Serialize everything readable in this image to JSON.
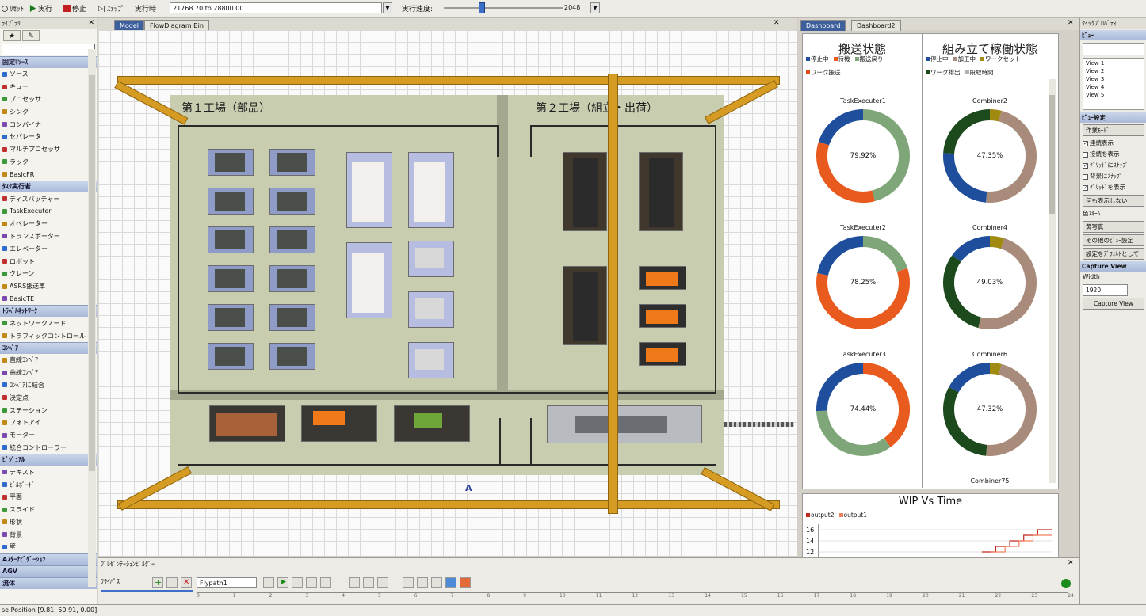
{
  "toolbar": {
    "reset_label": "ﾘｾｯﾄ",
    "run_label": "実行",
    "stop_label": "停止",
    "step_label": "ｽﾃｯﾌﾟ",
    "run_time_label": "実行時",
    "run_time_value": "21768.70  to  28800.00",
    "speed_label": "実行速度:",
    "speed_value": "2048"
  },
  "library": {
    "title": "ﾗｲﾌﾞﾗﾘ",
    "groups": [
      {
        "name": "固定ﾘｿｰｽ",
        "items": [
          "ソース",
          "キュー",
          "プロセッサ",
          "シンク",
          "コンバイナ",
          "セパレータ",
          "マルチプロセッサ",
          "ラック",
          "BasicFR"
        ]
      },
      {
        "name": "ﾀｽｸ実行者",
        "items": [
          "ディスパッチャー",
          "TaskExecuter",
          "オペレーター",
          "トランスポーター",
          "エレベーター",
          "ロボット",
          "クレーン",
          "ASRS搬送車",
          "BasicTE"
        ]
      },
      {
        "name": "ﾄﾗﾍﾞﾙﾈｯﾄﾜｰｸ",
        "items": [
          "ネットワークノード",
          "トラフィックコントロール"
        ]
      },
      {
        "name": "ｺﾝﾍﾞｱ",
        "items": [
          "直線ｺﾝﾍﾞｱ",
          "曲線ｺﾝﾍﾞｱ",
          "ｺﾝﾍﾞｱに結合",
          "決定点",
          "ステーション",
          "フォトアイ",
          "モーター",
          "統合コントローラー"
        ]
      },
      {
        "name": "ﾋﾞｼﾞｭｱﾙ",
        "items": [
          "テキスト",
          "ﾋﾞﾙﾎﾞｰﾄﾞ",
          "平面",
          "スライド",
          "形状",
          "背景",
          "壁"
        ]
      },
      {
        "name": "Aｽﾀｰﾅﾋﾞｹﾞｰｼｮﾝ",
        "items": []
      },
      {
        "name": "AGV",
        "items": []
      },
      {
        "name": "流体",
        "items": []
      }
    ]
  },
  "model_view": {
    "tabs": [
      "Model",
      "FlowDiagram Bin"
    ],
    "factory1_label": "第１工場（部品）",
    "factory2_label": "第２工場（組立・出荷）",
    "marker": "A"
  },
  "dashboard": {
    "tabs": [
      "Dashboard",
      "Dashboard2"
    ],
    "left_title": "搬送状態",
    "right_title": "組み立て稼働状態",
    "left_legend": [
      {
        "label": "停止中",
        "color": "#1f4e9c"
      },
      {
        "label": "待機",
        "color": "#e85a1e"
      },
      {
        "label": "搬送戻り",
        "color": "#7fa678"
      },
      {
        "label": "ワーク搬送",
        "color": "#e04a14"
      }
    ],
    "right_legend": [
      {
        "label": "停止中",
        "color": "#1f4e9c"
      },
      {
        "label": "加工中",
        "color": "#a88b7a"
      },
      {
        "label": "ワークセット",
        "color": "#a08a10"
      },
      {
        "label": "ワーク排出",
        "color": "#1c4a1c"
      },
      {
        "label": "段取時間",
        "color": "#b0b0b0"
      }
    ],
    "left_rings": [
      {
        "name": "TaskExecuter1",
        "pct": "79.92%",
        "segments": [
          {
            "v": 0.4592,
            "c": "#7fa678"
          },
          {
            "v": 0.34,
            "c": "#e85a1e"
          },
          {
            "v": 0.2008,
            "c": "#1f4e9c"
          }
        ]
      },
      {
        "name": "TaskExecuter2",
        "pct": "78.25%",
        "segments": [
          {
            "v": 0.2,
            "c": "#7fa678"
          },
          {
            "v": 0.5825,
            "c": "#e85a1e"
          },
          {
            "v": 0.2175,
            "c": "#1f4e9c"
          }
        ]
      },
      {
        "name": "TaskExecuter3",
        "pct": "74.44%",
        "segments": [
          {
            "v": 0.4,
            "c": "#e85a1e"
          },
          {
            "v": 0.3444,
            "c": "#7fa678"
          },
          {
            "v": 0.2556,
            "c": "#1f4e9c"
          }
        ]
      }
    ],
    "right_rings": [
      {
        "name": "Combiner2",
        "pct": "47.35%",
        "segments": [
          {
            "v": 0.04,
            "c": "#a08a10"
          },
          {
            "v": 0.4735,
            "c": "#a88b7a"
          },
          {
            "v": 0.2465,
            "c": "#1f4e9c"
          },
          {
            "v": 0.24,
            "c": "#1c4a1c"
          }
        ]
      },
      {
        "name": "Combiner4",
        "pct": "49.03%",
        "segments": [
          {
            "v": 0.05,
            "c": "#a08a10"
          },
          {
            "v": 0.4903,
            "c": "#a88b7a"
          },
          {
            "v": 0.3097,
            "c": "#1c4a1c"
          },
          {
            "v": 0.15,
            "c": "#1f4e9c"
          }
        ]
      },
      {
        "name": "Combiner6",
        "pct": "47.32%",
        "segments": [
          {
            "v": 0.04,
            "c": "#a08a10"
          },
          {
            "v": 0.4732,
            "c": "#a88b7a"
          },
          {
            "v": 0.3168,
            "c": "#1c4a1c"
          },
          {
            "v": 0.17,
            "c": "#1f4e9c"
          }
        ]
      }
    ],
    "right_bottom_label": "Combiner75"
  },
  "wip_chart": {
    "title": "WIP Vs Time",
    "legend": [
      {
        "label": "output2",
        "color": "#c0281c"
      },
      {
        "label": "output1",
        "color": "#f08060"
      }
    ],
    "yticks": [
      "16",
      "14",
      "12"
    ],
    "chart_data": {
      "type": "line",
      "title": "WIP Vs Time",
      "series": [
        {
          "name": "output2",
          "x": [
            0.7,
            0.76,
            0.76,
            0.82,
            0.82,
            0.88,
            0.88,
            0.94,
            0.94,
            1.0
          ],
          "y": [
            12,
            12,
            13,
            13,
            14,
            14,
            15,
            15,
            16,
            16
          ]
        },
        {
          "name": "output1",
          "x": [
            0.74,
            0.8,
            0.8,
            0.86,
            0.86,
            0.92,
            0.92,
            1.0
          ],
          "y": [
            12,
            12,
            13,
            13,
            14,
            14,
            15,
            15
          ]
        }
      ],
      "ylim": [
        11,
        17
      ]
    }
  },
  "properties": {
    "title": "ｸｲｯｸﾌﾟﾛﾊﾟﾃｨ",
    "view_group": "ﾋﾞｭｰ",
    "views": [
      "View 1",
      "View 2",
      "View 3",
      "View 4",
      "View 5"
    ],
    "view_settings_group": "ﾋﾞｭｰ設定",
    "work_mode": "作業ﾓｰﾄﾞ",
    "checks": [
      {
        "label": "連続表示",
        "checked": true
      },
      {
        "label": "接続を表示",
        "checked": false
      },
      {
        "label": "ｸﾞﾘｯﾄﾞにｽﾅｯﾌﾟ",
        "checked": true
      },
      {
        "label": "背景にｽﾅｯﾌﾟ",
        "checked": false
      },
      {
        "label": "ｸﾞﾘｯﾄﾞを表示",
        "checked": true
      }
    ],
    "hide_label": "何も表示しない",
    "color_scheme_label": "色ｽｷｰﾑ",
    "color_scheme_value": "黄写真",
    "other_view_settings": "その他のﾋﾞｭｰ設定",
    "set_default": "設定をﾃﾞﾌｫﾙﾄとして",
    "capture_group": "Capture View",
    "width_label": "Width",
    "width_value": "1920",
    "capture_button": "Capture View"
  },
  "presentation": {
    "title": "ﾌﾟﾚｾﾞﾝﾃｰｼｮﾝﾋﾞﾙﾀﾞｰ",
    "flypath_label": "ﾌﾗｲﾊﾟｽ",
    "flypath_value": "Flypath1",
    "timeline_ticks": [
      "0",
      "1",
      "2",
      "3",
      "4",
      "5",
      "6",
      "7",
      "8",
      "9",
      "10",
      "11",
      "12",
      "13",
      "14",
      "15",
      "16",
      "17",
      "18",
      "19",
      "20",
      "21",
      "22",
      "23",
      "24"
    ]
  },
  "status": {
    "text": "se Position [9.81, 50.91, 0.00]"
  }
}
